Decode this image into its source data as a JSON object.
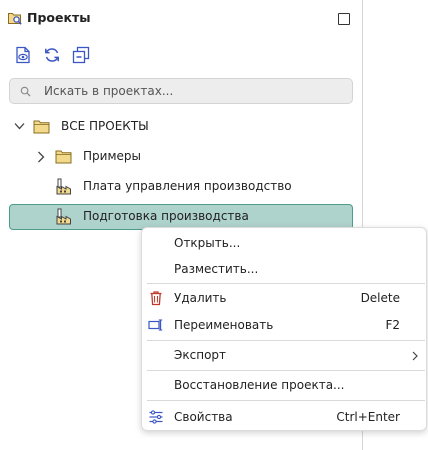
{
  "panel": {
    "title": "Проекты",
    "title_icon": "projects-search-icon",
    "maximize_icon": "maximize-icon",
    "toolbar": [
      {
        "name": "show-project-icon"
      },
      {
        "name": "refresh-icon"
      },
      {
        "name": "collapse-all-icon"
      }
    ]
  },
  "search": {
    "placeholder": "Искать в проектах..."
  },
  "tree": {
    "root": {
      "label": "ВСЕ ПРОЕКТЫ",
      "expanded": true,
      "icon": "folder-icon"
    },
    "items": [
      {
        "label": "Примеры",
        "type": "folder",
        "icon": "folder-icon",
        "expanded": false
      },
      {
        "label": "Плата управления производство",
        "type": "project",
        "icon": "factory-icon"
      },
      {
        "label": "Подготовка производства",
        "type": "project",
        "icon": "factory-icon",
        "selected": true
      }
    ]
  },
  "colors": {
    "selection_bg": "#aed2cc",
    "selection_border": "#4d9c8e",
    "folder": "#f2d98c",
    "delete_icon": "#c0392b",
    "accent_icon": "#3b57c4"
  },
  "context_menu": {
    "items": [
      {
        "label": "Открыть...",
        "shortcut": "",
        "icon": ""
      },
      {
        "label": "Разместить...",
        "shortcut": "",
        "icon": ""
      },
      {
        "label": "Удалить",
        "shortcut": "Delete",
        "icon": "trash-icon"
      },
      {
        "label": "Переименовать",
        "shortcut": "F2",
        "icon": "rename-icon"
      },
      {
        "label": "Экспорт",
        "shortcut": "",
        "icon": "",
        "submenu": true
      },
      {
        "label": "Восстановление проекта...",
        "shortcut": "",
        "icon": ""
      },
      {
        "label": "Свойства",
        "shortcut": "Ctrl+Enter",
        "icon": "properties-icon"
      }
    ]
  }
}
